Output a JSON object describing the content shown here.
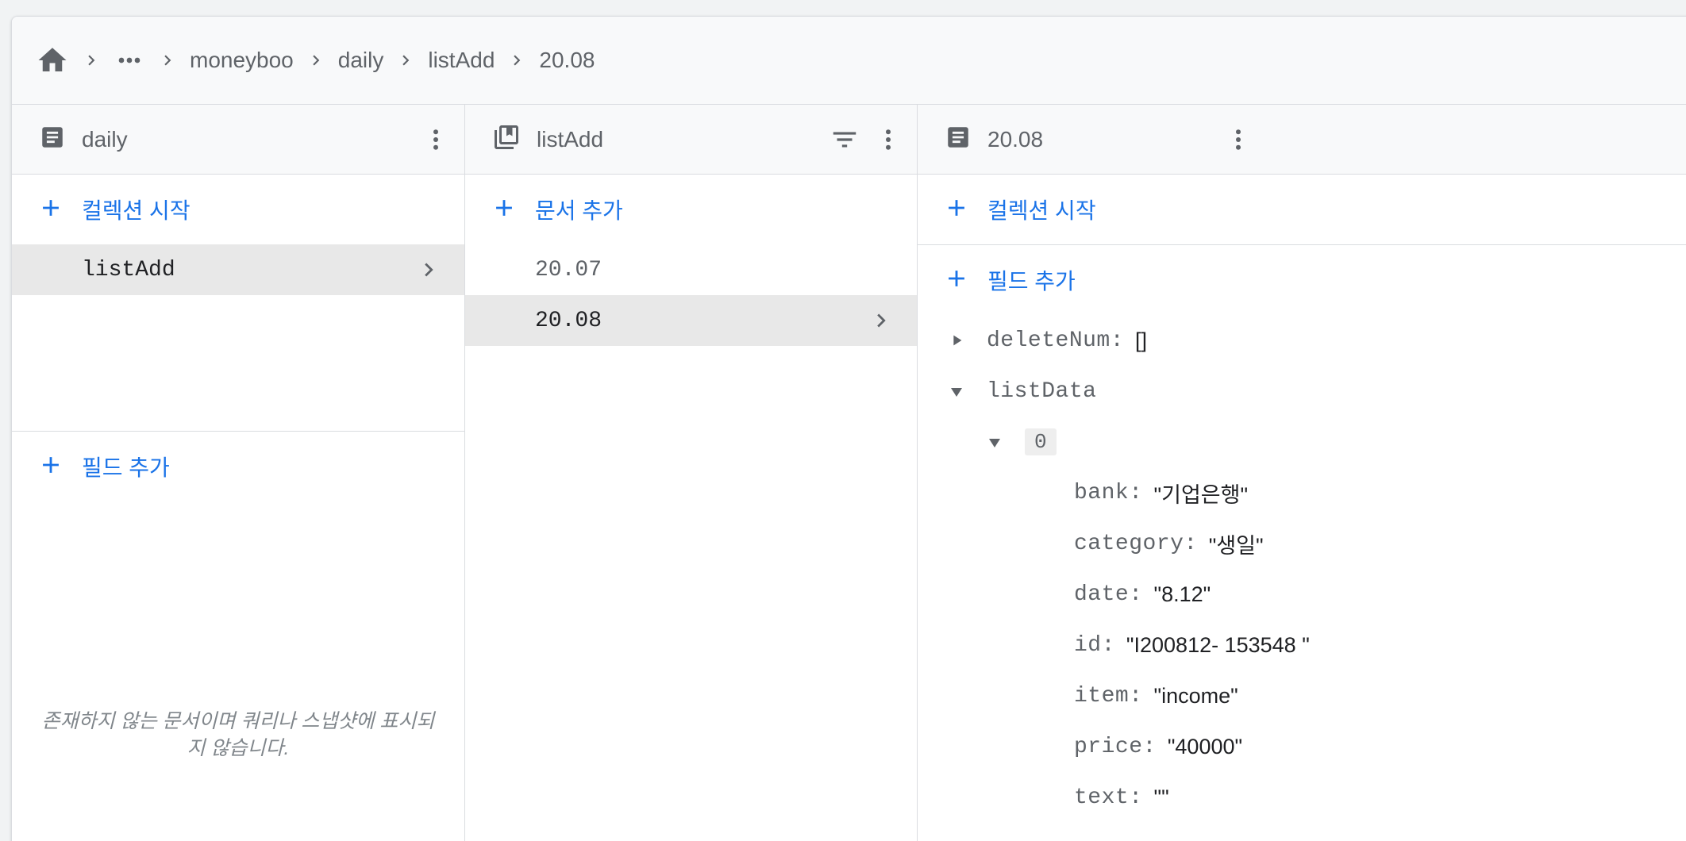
{
  "breadcrumb": {
    "items": [
      "moneyboo",
      "daily",
      "listAdd",
      "20.08"
    ]
  },
  "panels": {
    "left": {
      "title": "daily",
      "start_collection": "컬렉션 시작",
      "collections": [
        "listAdd"
      ],
      "add_field": "필드 추가",
      "note": "존재하지 않는 문서이며 쿼리나 스냅샷에 표시되지 않습니다."
    },
    "middle": {
      "title": "listAdd",
      "add_document": "문서 추가",
      "documents": [
        "20.07",
        "20.08"
      ]
    },
    "right": {
      "title": "20.08",
      "start_collection": "컬렉션 시작",
      "add_field": "필드 추가",
      "fields": {
        "deleteNum": {
          "key": "deleteNum:",
          "value": "[]"
        },
        "listData": {
          "key": "listData"
        },
        "index0": "0",
        "entries": [
          {
            "key": "bank:",
            "value": "\"기업은행\""
          },
          {
            "key": "category:",
            "value": "\"생일\""
          },
          {
            "key": "date:",
            "value": "\"8.12\""
          },
          {
            "key": "id:",
            "value": "\"I200812- 153548 \""
          },
          {
            "key": "item:",
            "value": "\"income\""
          },
          {
            "key": "price:",
            "value": "\"40000\""
          },
          {
            "key": "text:",
            "value": "\"\""
          }
        ]
      }
    }
  },
  "colors": {
    "accent": "#1a73e8",
    "selected_bg": "#e8e8e8",
    "icon": "#5f6368"
  }
}
